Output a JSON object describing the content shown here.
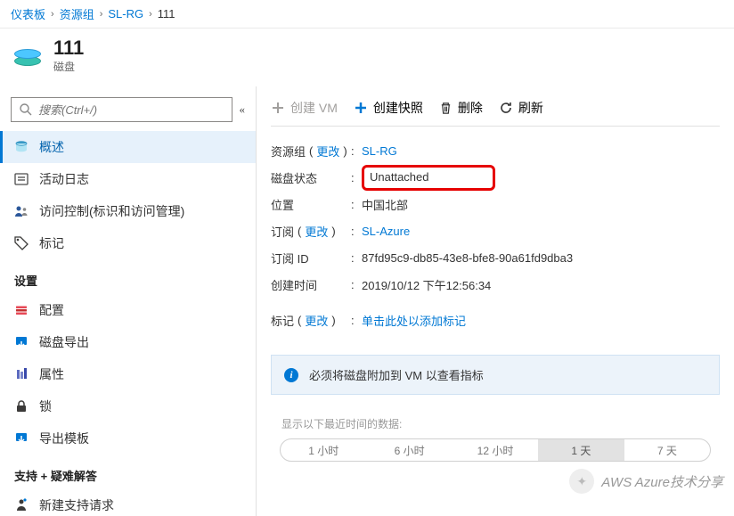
{
  "breadcrumb": {
    "items": [
      "仪表板",
      "资源组",
      "SL-RG",
      "111"
    ]
  },
  "header": {
    "title": "111",
    "subtitle": "磁盘"
  },
  "search": {
    "placeholder": "搜索(Ctrl+/)"
  },
  "sidebar": {
    "items": [
      {
        "id": "overview",
        "label": "概述",
        "active": true
      },
      {
        "id": "activity",
        "label": "活动日志"
      },
      {
        "id": "iam",
        "label": "访问控制(标识和访问管理)"
      },
      {
        "id": "tags",
        "label": "标记"
      }
    ],
    "group_settings": "设置",
    "settings_items": [
      {
        "id": "config",
        "label": "配置"
      },
      {
        "id": "export",
        "label": "磁盘导出"
      },
      {
        "id": "properties",
        "label": "属性"
      },
      {
        "id": "lock",
        "label": "锁"
      },
      {
        "id": "export-tpl",
        "label": "导出模板"
      }
    ],
    "group_support": "支持 + 疑难解答",
    "support_items": [
      {
        "id": "new-ticket",
        "label": "新建支持请求"
      }
    ]
  },
  "toolbar": {
    "create_vm": "创建 VM",
    "create_snapshot": "创建快照",
    "delete": "删除",
    "refresh": "刷新"
  },
  "props": {
    "rg_label": "资源组",
    "rg_value": "SL-RG",
    "status_label": "磁盘状态",
    "status_value": "Unattached",
    "location_label": "位置",
    "location_value": "中国北部",
    "sub_label": "订阅",
    "sub_value": "SL-Azure",
    "subid_label": "订阅 ID",
    "subid_value": "87fd95c9-db85-43e8-bfe8-90a61fd9dba3",
    "created_label": "创建时间",
    "created_value": "2019/10/12 下午12:56:34",
    "tags_label": "标记",
    "tags_value": "单击此处以添加标记",
    "change": "更改"
  },
  "banner": {
    "text": "必须将磁盘附加到 VM 以查看指标"
  },
  "timerange": {
    "label": "显示以下最近时间的数据:",
    "options": [
      "1 小时",
      "6 小时",
      "12 小时",
      "1 天",
      "7 天"
    ],
    "selected": "1 天"
  },
  "watermark": "AWS Azure技术分享"
}
